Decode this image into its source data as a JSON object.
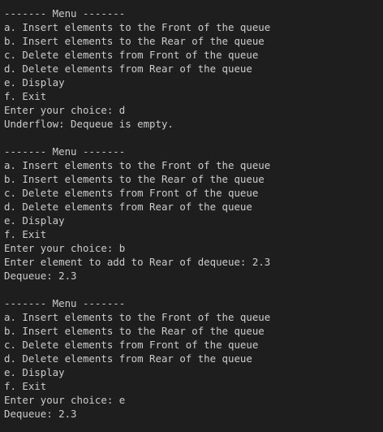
{
  "terminal": {
    "lines": [
      "------- Menu -------",
      "a. Insert elements to the Front of the queue",
      "b. Insert elements to the Rear of the queue",
      "c. Delete elements from Front of the queue",
      "d. Delete elements from Rear of the queue",
      "e. Display",
      "f. Exit",
      "Enter your choice: d",
      "Underflow: Dequeue is empty.",
      "",
      "------- Menu -------",
      "a. Insert elements to the Front of the queue",
      "b. Insert elements to the Rear of the queue",
      "c. Delete elements from Front of the queue",
      "d. Delete elements from Rear of the queue",
      "e. Display",
      "f. Exit",
      "Enter your choice: b",
      "Enter element to add to Rear of dequeue: 2.3",
      "Dequeue: 2.3",
      "",
      "------- Menu -------",
      "a. Insert elements to the Front of the queue",
      "b. Insert elements to the Rear of the queue",
      "c. Delete elements from Front of the queue",
      "d. Delete elements from Rear of the queue",
      "e. Display",
      "f. Exit",
      "Enter your choice: e",
      "Dequeue: 2.3"
    ]
  }
}
